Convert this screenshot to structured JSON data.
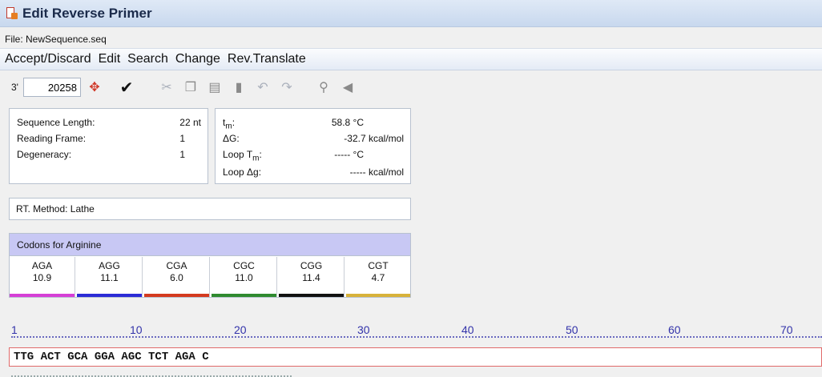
{
  "window": {
    "title": "Edit Reverse Primer",
    "file": "File: NewSequence.seq"
  },
  "menu": [
    "Accept/Discard",
    "Edit",
    "Search",
    "Change",
    "Rev.Translate"
  ],
  "toolbar": {
    "end_label": "3'",
    "position": "20258",
    "icons": [
      "goto-icon",
      "check-icon",
      "cut-icon",
      "copy-icon",
      "paste-icon",
      "delete-icon",
      "undo-icon",
      "redo-icon",
      "find-icon",
      "speaker-icon"
    ]
  },
  "sequence_info": {
    "length_label": "Sequence Length:",
    "length_value": "22 nt",
    "frame_label": "Reading Frame:",
    "frame_value": "1",
    "degeneracy_label": "Degeneracy:",
    "degeneracy_value": "1"
  },
  "thermo": {
    "tm_label": "t",
    "tm_sub": "m",
    "tm_value": "58.8 °C",
    "dg_label": "ΔG:",
    "dg_value": "-32.7 kcal/mol",
    "loop_tm_label": "Loop T",
    "loop_tm_sub": "m",
    "loop_tm_value": "----- °C",
    "loop_dg_label": "Loop Δg:",
    "loop_dg_value": "----- kcal/mol"
  },
  "method": {
    "text": "RT. Method: Lathe"
  },
  "codons": {
    "header": "Codons for Arginine",
    "items": [
      {
        "codon": "AGA",
        "value": "10.9",
        "color": "#d63fd6"
      },
      {
        "codon": "AGG",
        "value": "11.1",
        "color": "#2b2bd6"
      },
      {
        "codon": "CGA",
        "value": "6.0",
        "color": "#d43a1f"
      },
      {
        "codon": "CGC",
        "value": "11.0",
        "color": "#2f8a2f"
      },
      {
        "codon": "CGG",
        "value": "11.4",
        "color": "#111111"
      },
      {
        "codon": "CGT",
        "value": "4.7",
        "color": "#d8b23a"
      }
    ]
  },
  "ruler": {
    "labels": [
      "1",
      "10",
      "20",
      "30",
      "40",
      "50",
      "60",
      "70"
    ]
  },
  "sequence": {
    "text": "TTG ACT GCA GGA AGC TCT AGA C"
  }
}
